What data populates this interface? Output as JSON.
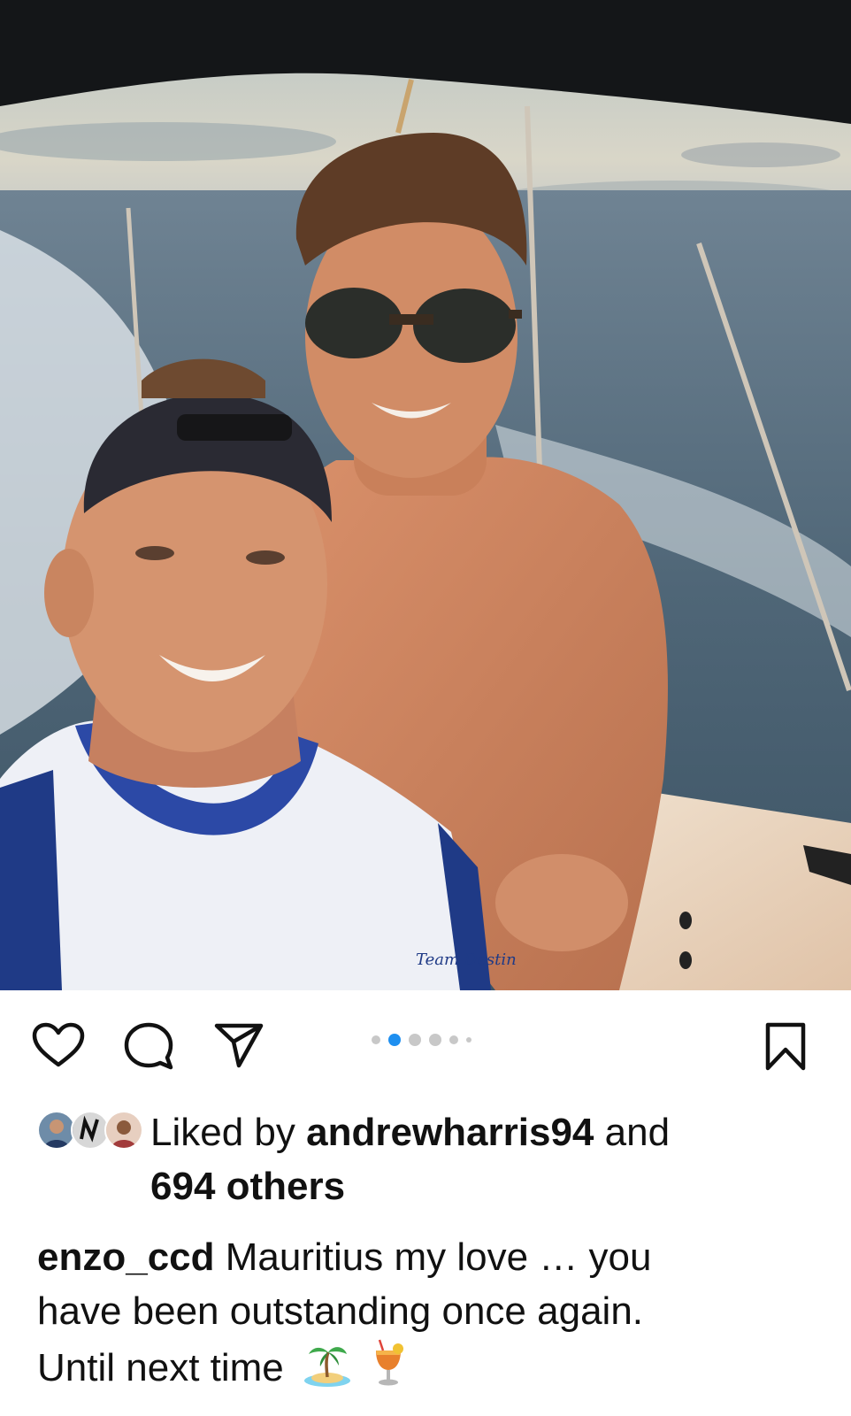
{
  "post": {
    "photo_icon": "selfie-photo",
    "carousel": {
      "total": 6,
      "active": 2
    },
    "accent_color": "#1e8ff0"
  },
  "actions": {
    "like_icon": "heart-icon",
    "comment_icon": "comment-bubble-icon",
    "share_icon": "paper-plane-icon",
    "save_icon": "bookmark-icon"
  },
  "likes": {
    "prefix": "Liked by",
    "user": "andrewharris94",
    "conjunction": "and",
    "others": "694 others"
  },
  "caption": {
    "username": "enzo_ccd",
    "line1": "Mauritius my love … you",
    "line2": "have been outstanding once again.",
    "line3": "Until next time",
    "emojis": [
      "🏝️",
      "🍹"
    ]
  }
}
